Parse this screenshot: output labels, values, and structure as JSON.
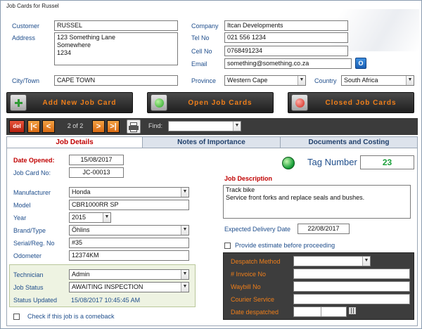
{
  "window": {
    "title": "Job Cards for Russel"
  },
  "customer": {
    "customer_label": "Customer",
    "customer_value": "RUSSEL",
    "address_label": "Address",
    "address_value": "123 Something Lane\nSomewhere\n1234",
    "city_label": "City/Town",
    "city_value": "CAPE TOWN",
    "company_label": "Company",
    "company_value": "Itcan Developments",
    "tel_label": "Tel No",
    "tel_value": "021 556 1234",
    "cell_label": "Cell No",
    "cell_value": "0768491234",
    "email_label": "Email",
    "email_value": "something@something.co.za",
    "province_label": "Province",
    "province_value": "Western Cape",
    "country_label": "Country",
    "country_value": "South Africa"
  },
  "actions": {
    "add": "Add New Job Card",
    "open": "Open Job Cards",
    "closed": "Closed Job Cards"
  },
  "nav": {
    "del": "del",
    "first": "|<",
    "prev": "<",
    "position": "2 of 2",
    "next": ">",
    "last": ">|",
    "find_label": "Find:",
    "find_value": ""
  },
  "tabs": [
    {
      "label": "Job Details"
    },
    {
      "label": "Notes of Importance"
    },
    {
      "label": "Documents and Costing"
    }
  ],
  "job": {
    "date_opened_label": "Date Opened:",
    "date_opened_value": "15/08/2017",
    "job_card_label": "Job Card No:",
    "job_card_value": "JC-00013",
    "tag_label": "Tag Number",
    "tag_value": "23",
    "manufacturer_label": "Manufacturer",
    "manufacturer_value": "Honda",
    "model_label": "Model",
    "model_value": "CBR1000RR SP",
    "year_label": "Year",
    "year_value": "2015",
    "brand_label": "Brand/Type",
    "brand_value": "Öhlins",
    "serial_label": "Serial/Reg. No",
    "serial_value": "#35",
    "odometer_label": "Odometer",
    "odometer_value": "12374KM",
    "technician_label": "Technician",
    "technician_value": "Admin",
    "status_label": "Job Status",
    "status_value": "AWAITING INSPECTION",
    "status_updated_label": "Status Updated",
    "status_updated_value": "15/08/2017 10:45:45 AM",
    "comeback_label": "Check if this job is a comeback",
    "description_label": "Job Description",
    "description_value": "Track bike\nService front forks and replace seals and bushes.",
    "delivery_label": "Expected Delivery Date",
    "delivery_value": "22/08/2017",
    "estimate_label": "Provide estimate before proceeding"
  },
  "despatch": {
    "method_label": "Despatch Method",
    "method_value": "",
    "invoice_label": "# Invoice No",
    "invoice_value": "",
    "waybill_label": "Waybill No",
    "waybill_value": "",
    "courier_label": "Courier Service",
    "courier_value": "",
    "date_label": "Date despatched",
    "date_value": ""
  },
  "colors": {
    "accent": "#f07f1a",
    "label_blue": "#1f4e8c",
    "label_red": "#c00000",
    "tag_green": "#1aa03a"
  }
}
